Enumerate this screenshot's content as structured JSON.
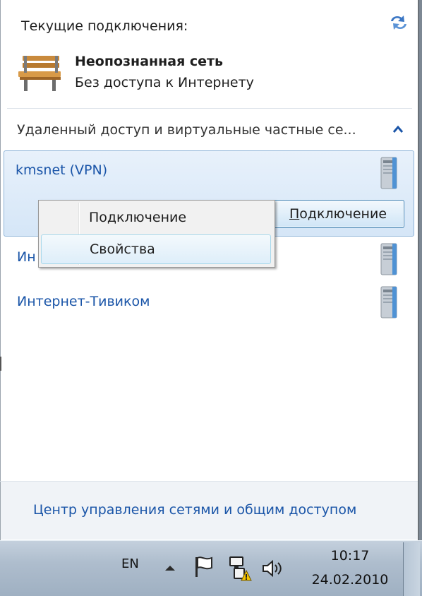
{
  "panel": {
    "current_connections_label": "Текущие подключения:",
    "network": {
      "name": "Неопознанная сеть",
      "status": "Без доступа к Интернету"
    },
    "section_title": "Удаленный доступ и виртуальные частные се...",
    "connections": [
      {
        "name": "kmsnet (VPN)",
        "button_label_accel": "П",
        "button_label_rest": "одключение"
      },
      {
        "name": "Ин"
      },
      {
        "name": "Интернет-Тивиком"
      }
    ],
    "context_menu": {
      "items": [
        {
          "label": "Подключение"
        },
        {
          "label": "Свойства"
        }
      ]
    },
    "footer_link": "Центр управления сетями и общим доступом"
  },
  "taskbar": {
    "language": "EN",
    "time": "10:17",
    "date": "24.02.2010"
  },
  "icons": {
    "refresh": "refresh-icon",
    "network_type": "bench-icon",
    "collapse": "chevron-up-icon",
    "connection": "server-icon",
    "tray_flag": "flag-icon",
    "tray_network": "network-warning-icon",
    "tray_volume": "speaker-icon"
  },
  "colors": {
    "link": "#1a55a8",
    "selection": "#d5e6f7",
    "taskbar": "#aebdcd"
  }
}
